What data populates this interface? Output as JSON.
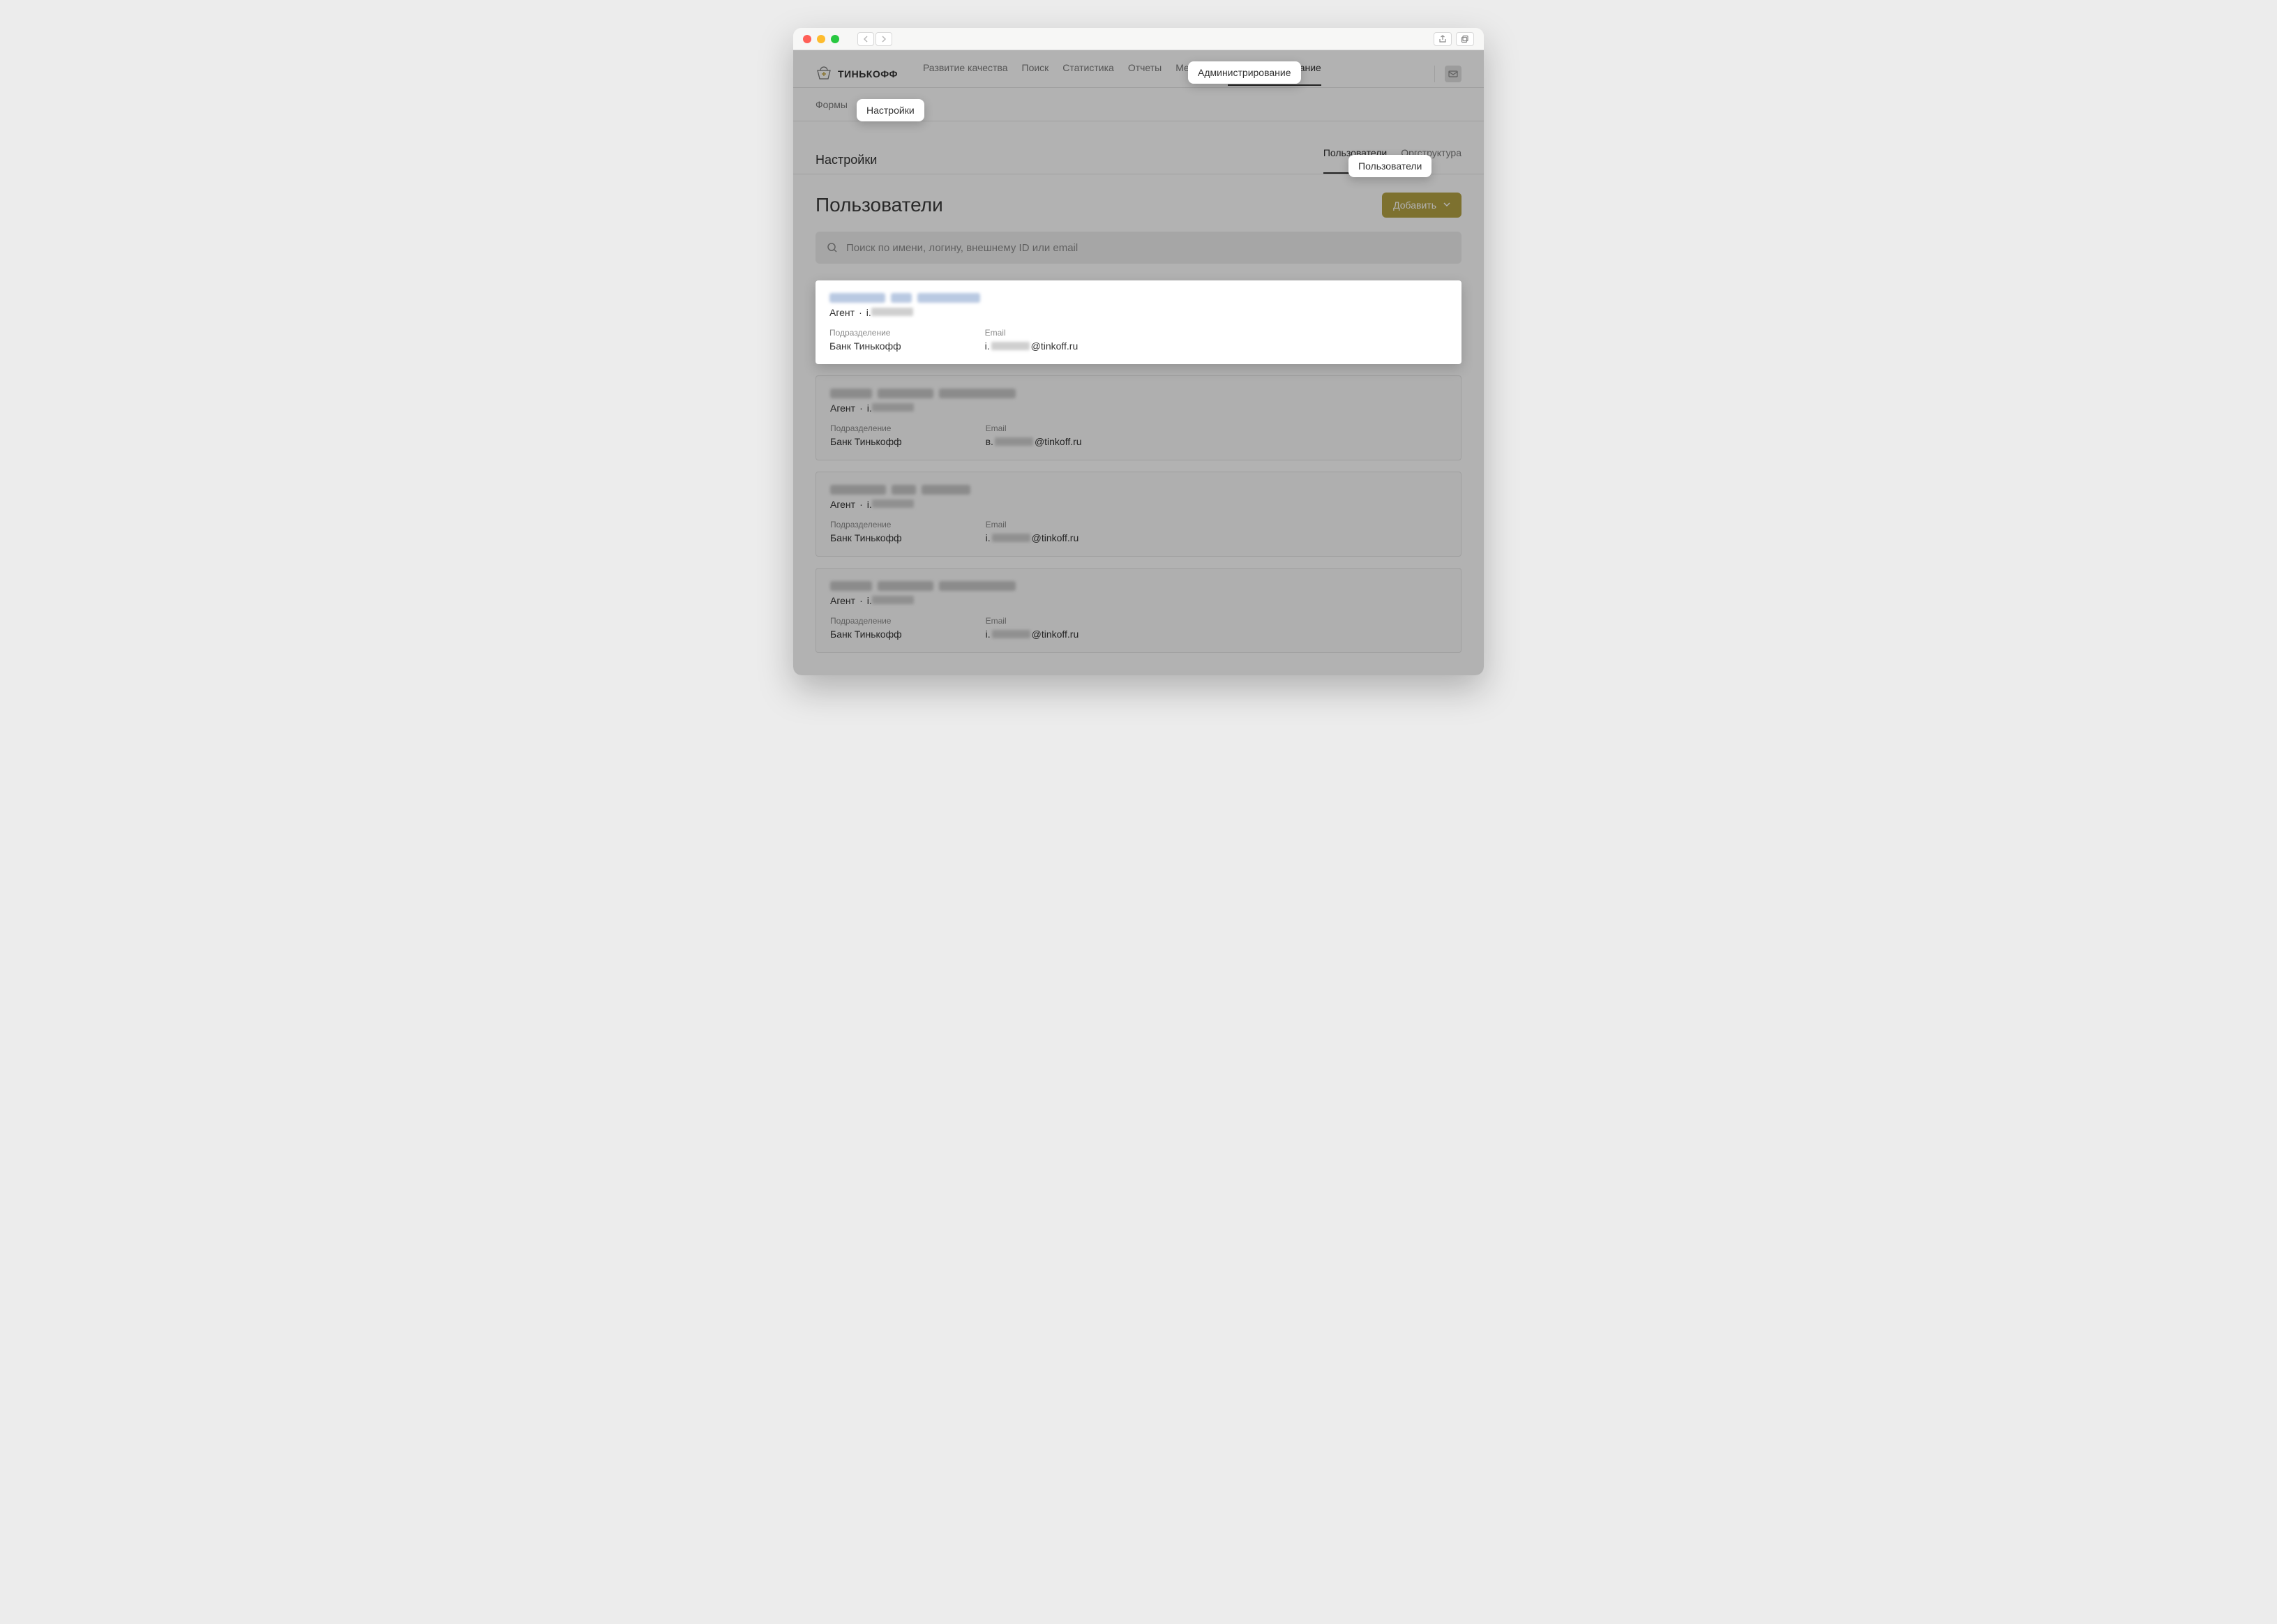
{
  "brand": "ТИНЬКОФФ",
  "mainnav": {
    "items": [
      "Развитие качества",
      "Поиск",
      "Статистика",
      "Отчеты",
      "Метрики",
      "Администрирование"
    ],
    "active_index": 5
  },
  "subnav": {
    "items": [
      "Формы",
      "Настройки"
    ],
    "active_index": 1
  },
  "section": {
    "title": "Настройки",
    "tabs": [
      "Пользователи",
      "Оргструктура"
    ],
    "active_index": 0
  },
  "page": {
    "title": "Пользователи",
    "add_label": "Добавить"
  },
  "search": {
    "placeholder": "Поиск по имени, логину, внешнему ID или email"
  },
  "card_labels": {
    "role": "Агент",
    "department_label": "Подразделение",
    "email_label": "Email"
  },
  "cards": [
    {
      "department": "Банк Тинькофф",
      "login_prefix": "i.",
      "email_prefix": "i.",
      "email_suffix": "@tinkoff.ru",
      "highlight": true
    },
    {
      "department": "Банк Тинькофф",
      "login_prefix": "i.",
      "email_prefix": "в.",
      "email_suffix": "@tinkoff.ru",
      "highlight": false
    },
    {
      "department": "Банк Тинькофф",
      "login_prefix": "i.",
      "email_prefix": "i.",
      "email_suffix": "@tinkoff.ru",
      "highlight": false
    },
    {
      "department": "Банк Тинькофф",
      "login_prefix": "i.",
      "email_prefix": "i.",
      "email_suffix": "@tinkoff.ru",
      "highlight": false
    }
  ],
  "callouts": {
    "nav": "Администрирование",
    "subnav": "Настройки",
    "section_tab": "Пользователи"
  }
}
